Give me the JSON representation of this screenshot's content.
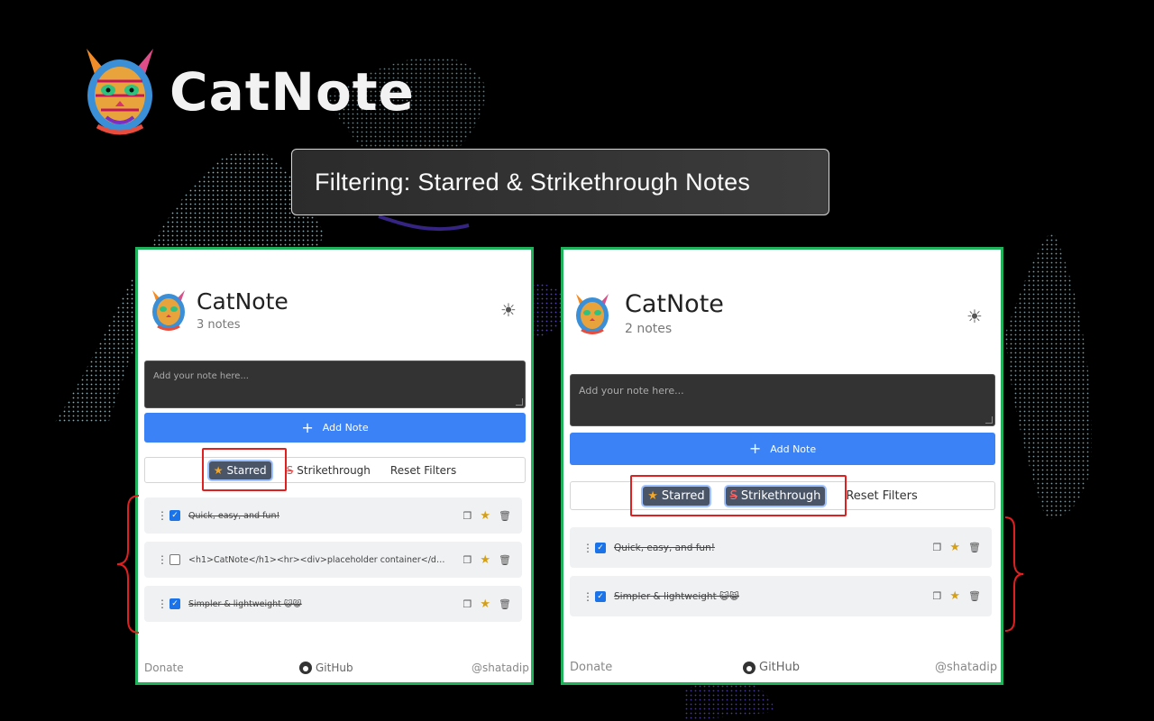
{
  "hero": {
    "title": "CatNote",
    "subtitle": "Filtering: Starred & Strikethrough Notes"
  },
  "left_panel": {
    "app_title": "CatNote",
    "note_count": "3 notes",
    "theme_icon": "sun-icon",
    "note_placeholder": "Add your note here...",
    "add_button": "Add Note",
    "filters": {
      "starred": "Starred",
      "strikethrough": "Strikethrough",
      "reset": "Reset Filters",
      "active": "starred"
    },
    "notes": [
      {
        "text": "Quick, easy, and fun!",
        "checked": true,
        "struck": true
      },
      {
        "text": "<h1>CatNote</h1><hr><div>placeholder container</di...",
        "checked": false,
        "struck": false
      },
      {
        "text": "Simpler & lightweight 😺😸",
        "checked": true,
        "struck": true
      }
    ],
    "footer": {
      "donate": "Donate",
      "github": "GitHub",
      "handle": "@shatadip"
    }
  },
  "right_panel": {
    "app_title": "CatNote",
    "note_count": "2 notes",
    "theme_icon": "sun-icon",
    "note_placeholder": "Add your note here...",
    "add_button": "Add Note",
    "filters": {
      "starred": "Starred",
      "strikethrough": "Strikethrough",
      "reset": "Reset Filters",
      "active": "starred,strikethrough"
    },
    "notes": [
      {
        "text": "Quick, easy, and fun!",
        "checked": true,
        "struck": true
      },
      {
        "text": "Simpler & lightweight 😺😸",
        "checked": true,
        "struck": true
      }
    ],
    "footer": {
      "donate": "Donate",
      "github": "GitHub",
      "handle": "@shatadip"
    }
  },
  "colors": {
    "panel_border": "#1fb25a",
    "highlight": "#e02020",
    "primary": "#3b82f6",
    "brace": "#e02020"
  }
}
